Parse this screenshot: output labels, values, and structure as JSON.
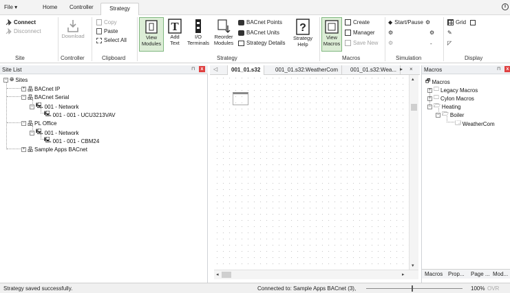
{
  "menubar": {
    "file": "File",
    "home": "Home",
    "controller": "Controller",
    "strategy": "Strategy"
  },
  "ribbon": {
    "site": {
      "connect": "Connect",
      "disconnect": "Disconnect",
      "group": "Site"
    },
    "controller": {
      "download": "Download",
      "group": "Controller"
    },
    "clipboard": {
      "copy": "Copy",
      "paste": "Paste",
      "select_all": "Select All",
      "group": "Clipboard"
    },
    "strategy": {
      "view_modules": [
        "View",
        "Modules"
      ],
      "add_text": [
        "Add",
        "Text"
      ],
      "io_terminals": [
        "I/O",
        "Terminals"
      ],
      "reorder_modules": [
        "Reorder",
        "Modules"
      ],
      "bacnet_points": "BACnet Points",
      "bacnet_units": "BACnet Units",
      "strategy_details": "Strategy Details",
      "strategy_help": [
        "Strategy",
        "Help"
      ],
      "group": "Strategy"
    },
    "macros": {
      "view_macros": [
        "View",
        "Macros"
      ],
      "create": "Create",
      "manager": "Manager",
      "save_new": "Save New",
      "group": "Macros"
    },
    "simulation": {
      "start_pause": "Start/Pause",
      "dash": "-",
      "group": "Simulation"
    },
    "display": {
      "grid": "Grid",
      "group": "Display"
    }
  },
  "site_list": {
    "title": "Site List",
    "tree": [
      {
        "label": "Sites"
      },
      {
        "label": "BACnet IP"
      },
      {
        "label": "BACnet Serial"
      },
      {
        "label": "001 - Network"
      },
      {
        "label": "001 - 001 - UCU3213VAV"
      },
      {
        "label": "PL Office"
      },
      {
        "label": "001 - Network"
      },
      {
        "label": "001 - 001 - CBM24"
      },
      {
        "label": "Sample Apps BACnet"
      }
    ]
  },
  "doc_tabs": [
    "001_01.s32",
    "001_01.s32:WeatherCom",
    "001_01.s32:Wea..."
  ],
  "macros_panel": {
    "title": "Macros",
    "tree": [
      {
        "label": "Macros"
      },
      {
        "label": "Legacy Macros"
      },
      {
        "label": "Cylon Macros"
      },
      {
        "label": "Heating"
      },
      {
        "label": "Boiler"
      },
      {
        "label": "WeatherCom"
      }
    ],
    "bottom_tabs": [
      "Macros",
      "Prop...",
      "Page ...",
      "Mod..."
    ]
  },
  "status": {
    "message": "Strategy saved successfully.",
    "connection": "Connected to: Sample Apps BACnet (3),",
    "zoom": "100%",
    "ovr": "OVR"
  },
  "colors": {
    "accent_green": "#7fb77e",
    "close_red": "#e04141"
  }
}
